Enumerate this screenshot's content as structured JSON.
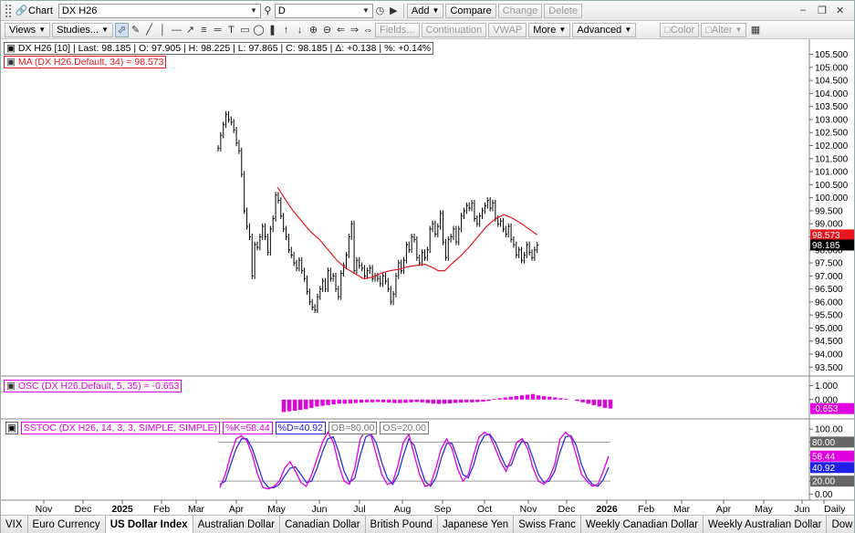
{
  "titlebar": {
    "title": "Chart",
    "symbol_value": "DX H26",
    "interval_value": "D",
    "buttons": [
      "Add",
      "Compare",
      "Change",
      "Delete"
    ]
  },
  "toolbar": {
    "views": "Views",
    "studies": "Studies...",
    "fields": "Fields...",
    "continuation": "Continuation",
    "vwap": "VWAP",
    "more": "More",
    "advanced": "Advanced",
    "color": "Color",
    "alter": "Alter"
  },
  "quote_box": {
    "symbol": "DX H26 [10]",
    "last": "Last: 98.185",
    "open": "O: 97.905",
    "high": "H: 98.225",
    "low": "L: 97.865",
    "close": "C: 98.185",
    "delta": "Δ: +0.138",
    "pct": "%: +0.14%"
  },
  "ma_label": "MA (DX H26.Default, 34) = 98.573",
  "osc_label": "OSC (DX H26.Default, 5, 35) = -0.653",
  "sstoc_label": {
    "main": "SSTOC (DX H26, 14, 3, 3, SIMPLE, SIMPLE)",
    "k": "%K=58.44",
    "d": "%D=40.92",
    "ob": "OB=80.00",
    "os": "OS=20.00"
  },
  "tabs": [
    "VIX",
    "Euro Currency",
    "US Dollar Index",
    "Australian Dollar",
    "Canadian Dollar",
    "British Pound",
    "Japanese Yen",
    "Swiss Franc",
    "Weekly Canadian Dollar",
    "Weekly Australian Dollar",
    "Dow Jones"
  ],
  "active_tab": 2,
  "colors": {
    "ma": "#e8181e",
    "osc": "#e000e0",
    "k": "#e000e0",
    "d": "#3030e0",
    "bars": "#000000"
  },
  "chart_data": {
    "type": "bar",
    "x_axis_labels": [
      "Nov",
      "Dec",
      "2025",
      "Feb",
      "Mar",
      "Apr",
      "May",
      "Jun",
      "Jul",
      "Aug",
      "Sep",
      "Oct",
      "Nov",
      "Dec",
      "2026",
      "Feb",
      "Mar",
      "Apr",
      "May",
      "Jun",
      "Daily"
    ],
    "price_axis": {
      "ticks": [
        "105.500",
        "105.000",
        "104.500",
        "104.000",
        "103.500",
        "103.000",
        "102.500",
        "102.000",
        "101.500",
        "101.000",
        "100.500",
        "100.000",
        "99.500",
        "99.000",
        "98.500",
        "98.000",
        "97.500",
        "97.000",
        "96.500",
        "96.000",
        "95.500",
        "95.000",
        "94.500",
        "94.000",
        "93.500"
      ],
      "ylim": [
        93.3,
        105.8
      ],
      "markers": [
        {
          "label": "98.573",
          "value": 98.573,
          "color": "#e8181e"
        },
        {
          "label": "98.185",
          "value": 98.185,
          "color": "#000000"
        }
      ]
    },
    "price_series": [
      [
        0,
        101.9
      ],
      [
        1,
        102.4
      ],
      [
        2,
        102.8
      ],
      [
        3,
        103.2
      ],
      [
        4,
        103.0
      ],
      [
        5,
        102.9
      ],
      [
        6,
        102.6
      ],
      [
        7,
        102.1
      ],
      [
        8,
        101.8
      ],
      [
        9,
        100.9
      ],
      [
        10,
        99.5
      ],
      [
        11,
        98.9
      ],
      [
        12,
        98.5
      ],
      [
        13,
        97.0
      ],
      [
        14,
        98.2
      ],
      [
        15,
        98.1
      ],
      [
        16,
        98.5
      ],
      [
        17,
        98.9
      ],
      [
        18,
        98.5
      ],
      [
        19,
        97.9
      ],
      [
        20,
        98.8
      ],
      [
        21,
        99.2
      ],
      [
        22,
        100.1
      ],
      [
        23,
        99.9
      ],
      [
        24,
        99.3
      ],
      [
        25,
        98.8
      ],
      [
        26,
        98.5
      ],
      [
        27,
        98.0
      ],
      [
        28,
        97.8
      ],
      [
        29,
        97.5
      ],
      [
        30,
        97.3
      ],
      [
        31,
        97.6
      ],
      [
        32,
        97.2
      ],
      [
        33,
        96.9
      ],
      [
        34,
        96.4
      ],
      [
        35,
        96.0
      ],
      [
        36,
        95.8
      ],
      [
        37,
        95.7
      ],
      [
        38,
        96.2
      ],
      [
        39,
        96.5
      ],
      [
        40,
        96.8
      ],
      [
        41,
        96.5
      ],
      [
        42,
        97.2
      ],
      [
        43,
        96.9
      ],
      [
        44,
        97.0
      ],
      [
        45,
        96.5
      ],
      [
        46,
        96.2
      ],
      [
        47,
        97.1
      ],
      [
        48,
        97.4
      ],
      [
        49,
        97.8
      ],
      [
        50,
        98.5
      ],
      [
        51,
        99.0
      ],
      [
        52,
        97.2
      ],
      [
        53,
        97.6
      ],
      [
        54,
        97.4
      ],
      [
        55,
        97.3
      ],
      [
        56,
        97.0
      ],
      [
        57,
        97.2
      ],
      [
        58,
        97.3
      ],
      [
        59,
        96.9
      ],
      [
        60,
        97.0
      ],
      [
        61,
        96.9
      ],
      [
        62,
        96.7
      ],
      [
        63,
        97.0
      ],
      [
        64,
        96.8
      ],
      [
        65,
        96.5
      ],
      [
        66,
        96.0
      ],
      [
        67,
        96.3
      ],
      [
        68,
        97.0
      ],
      [
        69,
        97.5
      ],
      [
        70,
        97.2
      ],
      [
        71,
        97.6
      ],
      [
        72,
        98.2
      ],
      [
        73,
        98.0
      ],
      [
        74,
        98.5
      ],
      [
        75,
        98.4
      ],
      [
        76,
        97.7
      ],
      [
        77,
        97.5
      ],
      [
        78,
        97.9
      ],
      [
        79,
        97.7
      ],
      [
        80,
        98.0
      ],
      [
        81,
        98.8
      ],
      [
        82,
        99.0
      ],
      [
        83,
        98.6
      ],
      [
        84,
        98.9
      ],
      [
        85,
        99.4
      ],
      [
        86,
        98.3
      ],
      [
        87,
        97.7
      ],
      [
        88,
        98.4
      ],
      [
        89,
        98.5
      ],
      [
        90,
        98.8
      ],
      [
        91,
        98.3
      ],
      [
        92,
        98.8
      ],
      [
        93,
        99.3
      ],
      [
        94,
        99.5
      ],
      [
        95,
        99.7
      ],
      [
        96,
        99.6
      ],
      [
        97,
        99.8
      ],
      [
        98,
        99.2
      ],
      [
        99,
        99.0
      ],
      [
        100,
        99.3
      ],
      [
        101,
        99.5
      ],
      [
        102,
        99.7
      ],
      [
        103,
        99.9
      ],
      [
        104,
        99.6
      ],
      [
        105,
        99.8
      ],
      [
        106,
        99.2
      ],
      [
        107,
        99.0
      ],
      [
        108,
        99.1
      ],
      [
        109,
        98.8
      ],
      [
        110,
        98.6
      ],
      [
        111,
        98.9
      ],
      [
        112,
        98.4
      ],
      [
        113,
        98.2
      ],
      [
        114,
        97.8
      ],
      [
        115,
        98.0
      ],
      [
        116,
        97.6
      ],
      [
        117,
        97.8
      ],
      [
        118,
        98.2
      ],
      [
        119,
        97.9
      ],
      [
        120,
        97.7
      ],
      [
        121,
        98.0
      ],
      [
        122,
        98.185
      ]
    ],
    "ma_series": [
      [
        27,
        100.4
      ],
      [
        30,
        100.0
      ],
      [
        34,
        99.5
      ],
      [
        38,
        99.1
      ],
      [
        42,
        98.7
      ],
      [
        46,
        98.4
      ],
      [
        50,
        98.0
      ],
      [
        54,
        97.6
      ],
      [
        58,
        97.3
      ],
      [
        62,
        97.1
      ],
      [
        66,
        96.9
      ],
      [
        70,
        96.95
      ],
      [
        74,
        97.1
      ],
      [
        78,
        97.2
      ],
      [
        82,
        97.25
      ],
      [
        86,
        97.35
      ],
      [
        90,
        97.4
      ],
      [
        94,
        97.45
      ],
      [
        98,
        97.3
      ],
      [
        100,
        97.2
      ],
      [
        103,
        97.2
      ],
      [
        106,
        97.45
      ],
      [
        110,
        97.75
      ],
      [
        114,
        98.1
      ],
      [
        118,
        98.5
      ],
      [
        122,
        98.9
      ],
      [
        126,
        99.2
      ],
      [
        130,
        99.35
      ],
      [
        134,
        99.2
      ],
      [
        138,
        99.0
      ],
      [
        142,
        98.75
      ],
      [
        145,
        98.573
      ]
    ],
    "x_index_max": 150,
    "osc": {
      "ticks": [
        "1.000",
        "0.000"
      ],
      "ylim": [
        -1.2,
        1.5
      ],
      "marker": {
        "label": "-0.653",
        "value": -0.653
      },
      "values": [
        -0.9,
        -0.85,
        -0.8,
        -0.75,
        -0.7,
        -0.6,
        -0.5,
        -0.45,
        -0.4,
        -0.35,
        -0.3,
        -0.3,
        -0.28,
        -0.25,
        -0.22,
        -0.2,
        -0.2,
        -0.18,
        -0.2,
        -0.22,
        -0.25,
        -0.25,
        -0.23,
        -0.2,
        -0.18,
        -0.2,
        -0.25,
        -0.3,
        -0.32,
        -0.3,
        -0.28,
        -0.25,
        -0.22,
        -0.2,
        -0.2,
        -0.18,
        -0.15,
        -0.1,
        0.05,
        0.1,
        0.15,
        0.2,
        0.25,
        0.3,
        0.35,
        0.4,
        0.3,
        0.25,
        0.2,
        0.15,
        0.1,
        0.05,
        0.0,
        -0.1,
        -0.2,
        -0.3,
        -0.4,
        -0.5,
        -0.6,
        -0.65
      ]
    },
    "sstoc": {
      "ticks": [
        "100.00",
        "80.00",
        "60.00",
        "40.00",
        "20.00",
        "0.00"
      ],
      "ylim": [
        -5,
        110
      ],
      "ob": 80,
      "os": 20,
      "markers": [
        {
          "label": "80.00",
          "value": 80,
          "color": "#666666"
        },
        {
          "label": "58.44",
          "value": 58.44,
          "color": "#e000e0"
        },
        {
          "label": "40.92",
          "value": 40.92,
          "color": "#2020e8"
        },
        {
          "label": "20.00",
          "value": 20,
          "color": "#666666"
        }
      ],
      "k_values": [
        10,
        30,
        60,
        85,
        90,
        82,
        60,
        30,
        10,
        8,
        12,
        20,
        40,
        50,
        35,
        18,
        12,
        30,
        55,
        80,
        95,
        80,
        45,
        20,
        15,
        40,
        85,
        98,
        90,
        60,
        30,
        15,
        18,
        45,
        80,
        92,
        60,
        30,
        12,
        15,
        40,
        70,
        85,
        70,
        40,
        20,
        30,
        60,
        88,
        95,
        90,
        70,
        50,
        35,
        55,
        80,
        85,
        70,
        40,
        20,
        15,
        25,
        45,
        85,
        95,
        88,
        60,
        30,
        20,
        12,
        15,
        35,
        58.44
      ],
      "d_values": [
        15,
        20,
        45,
        70,
        85,
        85,
        70,
        45,
        20,
        10,
        10,
        15,
        28,
        40,
        42,
        30,
        18,
        20,
        40,
        65,
        85,
        88,
        65,
        35,
        18,
        25,
        60,
        88,
        92,
        78,
        48,
        25,
        15,
        30,
        60,
        85,
        75,
        45,
        20,
        12,
        25,
        55,
        78,
        78,
        55,
        30,
        25,
        45,
        75,
        90,
        92,
        80,
        60,
        42,
        45,
        68,
        82,
        78,
        55,
        30,
        18,
        20,
        35,
        65,
        88,
        90,
        75,
        45,
        25,
        15,
        12,
        22,
        40.92
      ]
    }
  }
}
